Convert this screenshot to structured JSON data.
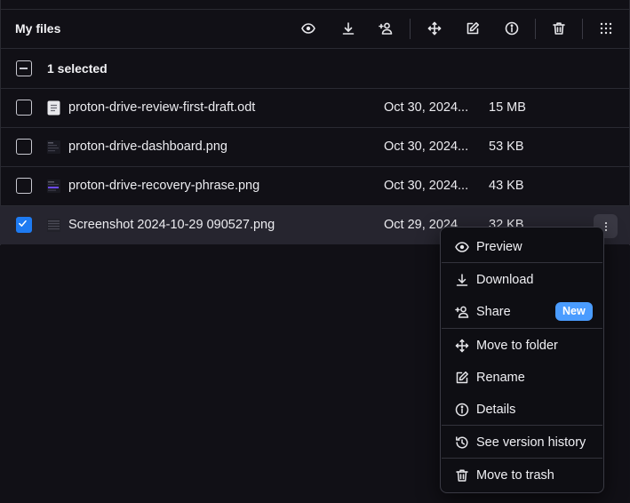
{
  "toolbar": {
    "title": "My files",
    "buttons": [
      {
        "name": "preview",
        "icon": "eye-icon"
      },
      {
        "name": "download",
        "icon": "download-icon"
      },
      {
        "name": "share",
        "icon": "share-user-icon"
      },
      {
        "name": "move",
        "icon": "move-icon"
      },
      {
        "name": "rename",
        "icon": "edit-icon"
      },
      {
        "name": "details",
        "icon": "info-icon"
      },
      {
        "name": "trash",
        "icon": "trash-icon"
      },
      {
        "name": "more",
        "icon": "grid-dots-icon"
      }
    ]
  },
  "selection": {
    "label": "1 selected"
  },
  "files": [
    {
      "name": "proton-drive-review-first-draft.odt",
      "date": "Oct 30, 2024...",
      "size": "15 MB",
      "icon": "document-icon",
      "selected": false
    },
    {
      "name": "proton-drive-dashboard.png",
      "date": "Oct 30, 2024...",
      "size": "53 KB",
      "icon": "image-thumbnail-icon",
      "selected": false
    },
    {
      "name": "proton-drive-recovery-phrase.png",
      "date": "Oct 30, 2024...",
      "size": "43 KB",
      "icon": "image-thumbnail-icon",
      "selected": false
    },
    {
      "name": "Screenshot 2024-10-29 090527.png",
      "date": "Oct 29, 2024...",
      "size": "32 KB",
      "icon": "image-thumbnail-icon",
      "selected": true
    }
  ],
  "context_menu": {
    "items": [
      {
        "label": "Preview",
        "icon": "eye-icon"
      },
      {
        "label": "Download",
        "icon": "download-icon"
      },
      {
        "label": "Share",
        "icon": "share-user-icon",
        "badge": "New"
      },
      {
        "label": "Move to folder",
        "icon": "move-icon"
      },
      {
        "label": "Rename",
        "icon": "edit-icon"
      },
      {
        "label": "Details",
        "icon": "info-icon"
      },
      {
        "label": "See version history",
        "icon": "history-icon"
      },
      {
        "label": "Move to trash",
        "icon": "trash-icon"
      }
    ]
  },
  "colors": {
    "background": "#111016",
    "selected_row": "#26252F",
    "accent": "#1E7BF2",
    "badge": "#4A9CFF"
  }
}
